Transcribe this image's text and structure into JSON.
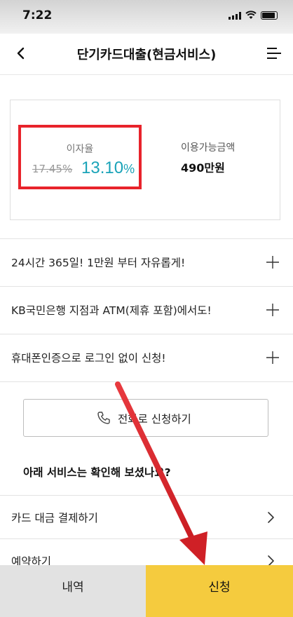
{
  "status_bar": {
    "time": "7:22",
    "signal_icon": "signal-icon",
    "wifi_icon": "wifi-icon",
    "battery_icon": "battery-icon"
  },
  "header": {
    "title": "단기카드대출(현금서비스)",
    "back_icon": "chevron-left-icon",
    "menu_icon": "menu-icon"
  },
  "rate": {
    "label": "이자율",
    "old_value": "17.45%",
    "new_value": "13.10",
    "new_unit": "%"
  },
  "available": {
    "label": "이용가능금액",
    "value": "490만원"
  },
  "faq": [
    {
      "text": "24시간 365일! 1만원 부터 자유롭게!"
    },
    {
      "text": "KB국민은행 지점과 ATM(제휴 포함)에서도!"
    },
    {
      "text": "휴대폰인증으로 로그인 없이 신청!"
    }
  ],
  "phone_button": {
    "label": "전화로 신청하기",
    "icon": "phone-icon"
  },
  "section": {
    "title": "아래 서비스는 확인해 보셨나요?"
  },
  "links": [
    {
      "text": "카드 대금 결제하기"
    },
    {
      "text": "예약하기"
    }
  ],
  "bottom_bar": {
    "history_label": "내역",
    "apply_label": "신청"
  },
  "colors": {
    "accent_teal": "#1aa3b8",
    "highlight_red": "#e8232b",
    "apply_yellow": "#f5cb3e",
    "annotation_arrow": "#e0282e"
  }
}
